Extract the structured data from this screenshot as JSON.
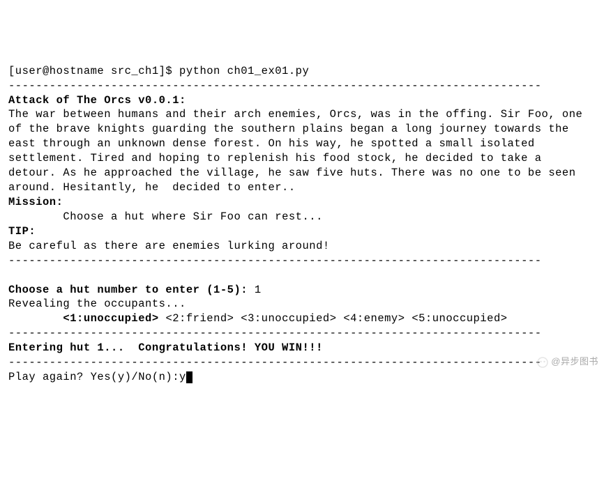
{
  "prompt": "[user@hostname src_ch1]$ python ch01_ex01.py",
  "divider": "------------------------------------------------------------------------------",
  "title": "Attack of The Orcs v0.0.1:",
  "story_line1": "The war between humans and their arch enemies, Orcs, was in the offing. Sir Foo, one of the brave knights guarding the southern plains began a long journey towards the east through an unknown dense forest. On his way, he spotted a small isolated settlement. Tired and hoping to replenish his food stock, he decided to take a detour. As he approached the village, he saw five huts. There was no one to be seen around. Hesitantly, he  decided to enter..",
  "mission_label": "Mission:",
  "mission_text": "        Choose a hut where Sir Foo can rest...",
  "tip_label": "TIP:",
  "tip_text": "Be careful as there are enemies lurking around!",
  "choose_prompt": "Choose a hut number to enter (1-5): ",
  "choose_input": "1",
  "revealing": "Revealing the occupants...",
  "huts_prefix": "        ",
  "huts": {
    "h1": "<1:unoccupied>",
    "h2": " <2:friend> ",
    "h3": "<3:unoccupied> ",
    "h4": "<4:enemy> ",
    "h5": "<5:unoccupied>"
  },
  "result": "Entering hut 1...  Congratulations! YOU WIN!!!",
  "play_again_prompt": "Play again? Yes(y)/No(n):",
  "play_again_input": "y",
  "watermark": "@异步图书"
}
